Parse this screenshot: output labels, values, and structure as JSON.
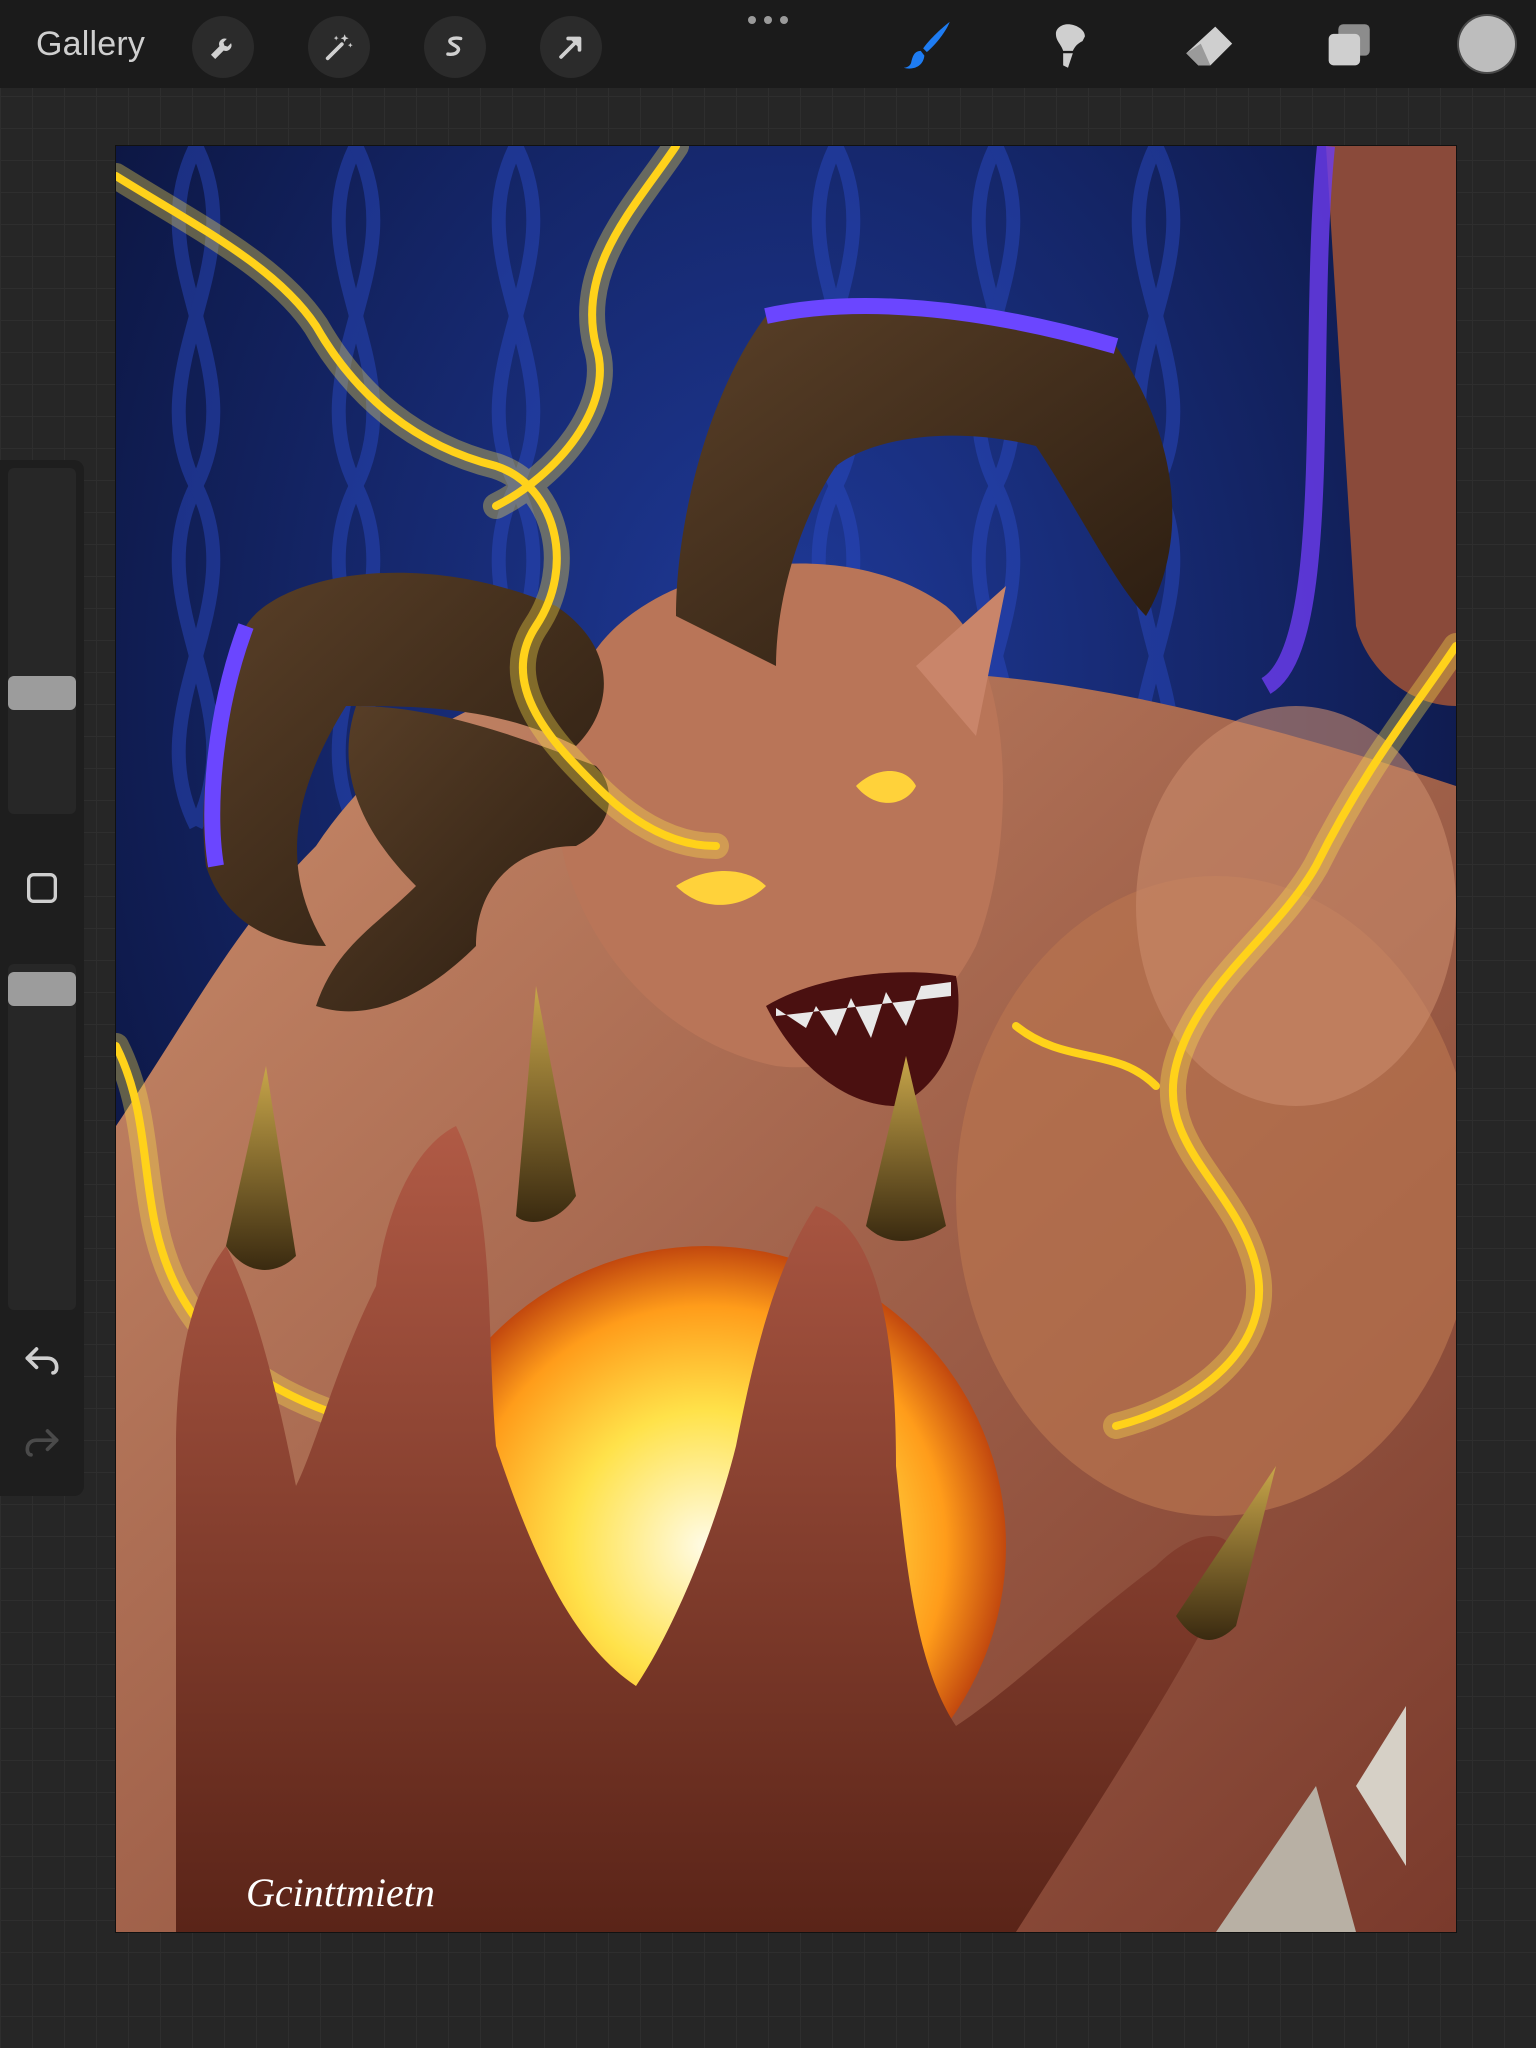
{
  "topbar": {
    "gallery_label": "Gallery",
    "left_tools": [
      {
        "name": "actions",
        "icon": "wrench-icon"
      },
      {
        "name": "adjustments",
        "icon": "magic-wand-icon"
      },
      {
        "name": "selection",
        "icon": "selection-s-icon"
      },
      {
        "name": "transform",
        "icon": "arrow-cursor-icon"
      }
    ],
    "center_menu_icon": "more-dots-icon",
    "right_tools": [
      {
        "name": "brush",
        "icon": "brush-icon",
        "active": true
      },
      {
        "name": "smudge",
        "icon": "smudge-icon",
        "active": false
      },
      {
        "name": "eraser",
        "icon": "eraser-icon",
        "active": false
      },
      {
        "name": "layers",
        "icon": "layers-icon",
        "active": false
      }
    ],
    "color_swatch": "#bdbdbd"
  },
  "sidebar": {
    "brush_size_slider": {
      "level": 0.7
    },
    "modify_button_icon": "square-icon",
    "opacity_slider": {
      "level": 0.85
    },
    "undo_icon": "undo-icon",
    "redo_icon": "redo-icon"
  },
  "colors": {
    "accent_active_tool": "#1e7cf2",
    "topbar_bg": "#1b1b1b",
    "workspace_bg": "#262626"
  },
  "canvas": {
    "artwork_subject": "horned-demon-illustration",
    "signature": "Gcinttmietn"
  }
}
